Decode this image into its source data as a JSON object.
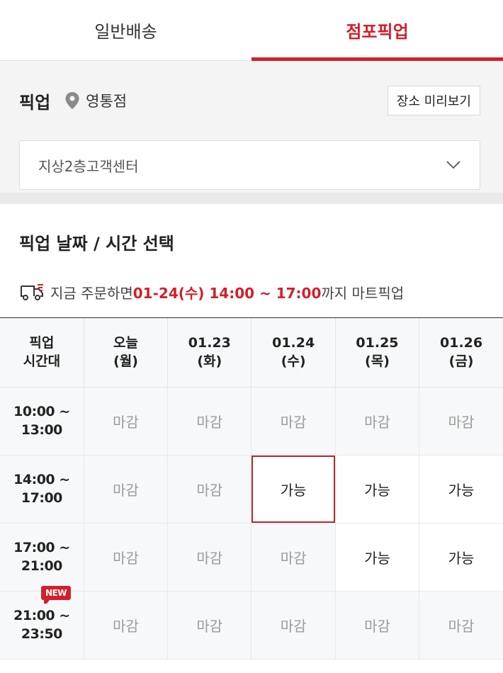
{
  "tabs": [
    {
      "label": "일반배송",
      "active": false
    },
    {
      "label": "점포픽업",
      "active": true
    }
  ],
  "pickup": {
    "title": "픽업",
    "store_icon": "location-pin-icon",
    "store_name": "영통점",
    "preview_label": "장소 미리보기",
    "location_value": "지상2층고객센터"
  },
  "datetime": {
    "title": "픽업 날짜 / 시간 선택",
    "notice_prefix": "지금 주문하면 ",
    "notice_highlight": "01-24(수) 14:00 ~ 17:00",
    "notice_suffix": "까지 마트픽업"
  },
  "table": {
    "header": [
      {
        "line1": "픽업",
        "line2": "시간대"
      },
      {
        "line1": "오늘",
        "line2": "(월)"
      },
      {
        "line1": "01.23",
        "line2": "(화)"
      },
      {
        "line1": "01.24",
        "line2": "(수)"
      },
      {
        "line1": "01.25",
        "line2": "(목)"
      },
      {
        "line1": "01.26",
        "line2": "(금)"
      }
    ],
    "rows": [
      {
        "start": "10:00 ~",
        "end": "13:00",
        "badge": "",
        "cells": [
          "마감",
          "마감",
          "마감",
          "마감",
          "마감"
        ]
      },
      {
        "start": "14:00 ~",
        "end": "17:00",
        "badge": "",
        "cells": [
          "마감",
          "마감",
          "가능",
          "가능",
          "가능"
        ]
      },
      {
        "start": "17:00 ~",
        "end": "21:00",
        "badge": "",
        "cells": [
          "마감",
          "마감",
          "마감",
          "가능",
          "가능"
        ]
      },
      {
        "start": "21:00 ~",
        "end": "23:50",
        "badge": "NEW",
        "cells": [
          "마감",
          "마감",
          "마감",
          "마감",
          "마감"
        ]
      }
    ],
    "selected": {
      "row": 1,
      "col": 2
    }
  },
  "colors": {
    "accent": "#d31f2a",
    "closed_bg": "#f7f8f9"
  }
}
